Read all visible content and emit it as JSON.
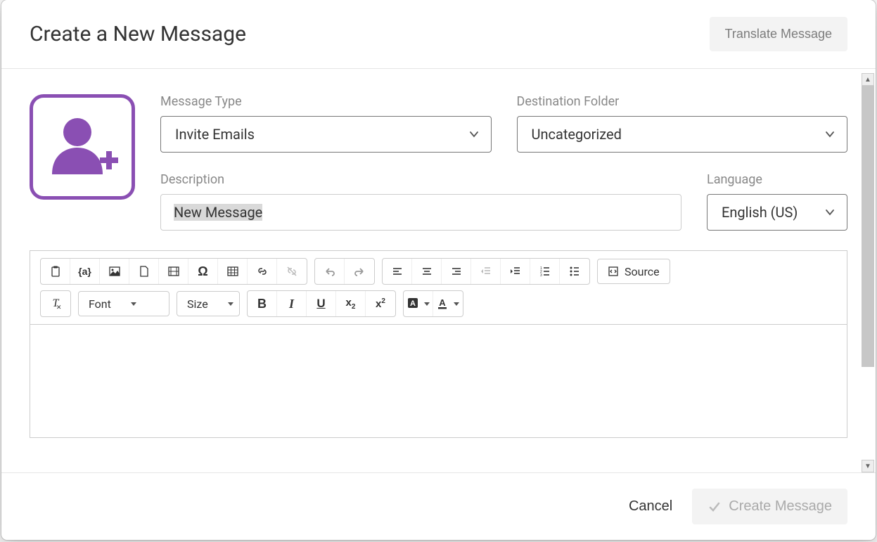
{
  "header": {
    "title": "Create a New Message",
    "translate_label": "Translate Message"
  },
  "fields": {
    "message_type": {
      "label": "Message Type",
      "value": "Invite Emails"
    },
    "destination_folder": {
      "label": "Destination Folder",
      "value": "Uncategorized"
    },
    "description": {
      "label": "Description",
      "value": "New Message"
    },
    "language": {
      "label": "Language",
      "value": "English (US)"
    }
  },
  "toolbar": {
    "font_label": "Font",
    "size_label": "Size",
    "source_label": "Source"
  },
  "footer": {
    "cancel_label": "Cancel",
    "create_label": "Create Message"
  },
  "icons": {
    "message_type_icon": "add-user-icon"
  },
  "colors": {
    "accent": "#8a4fb3"
  }
}
